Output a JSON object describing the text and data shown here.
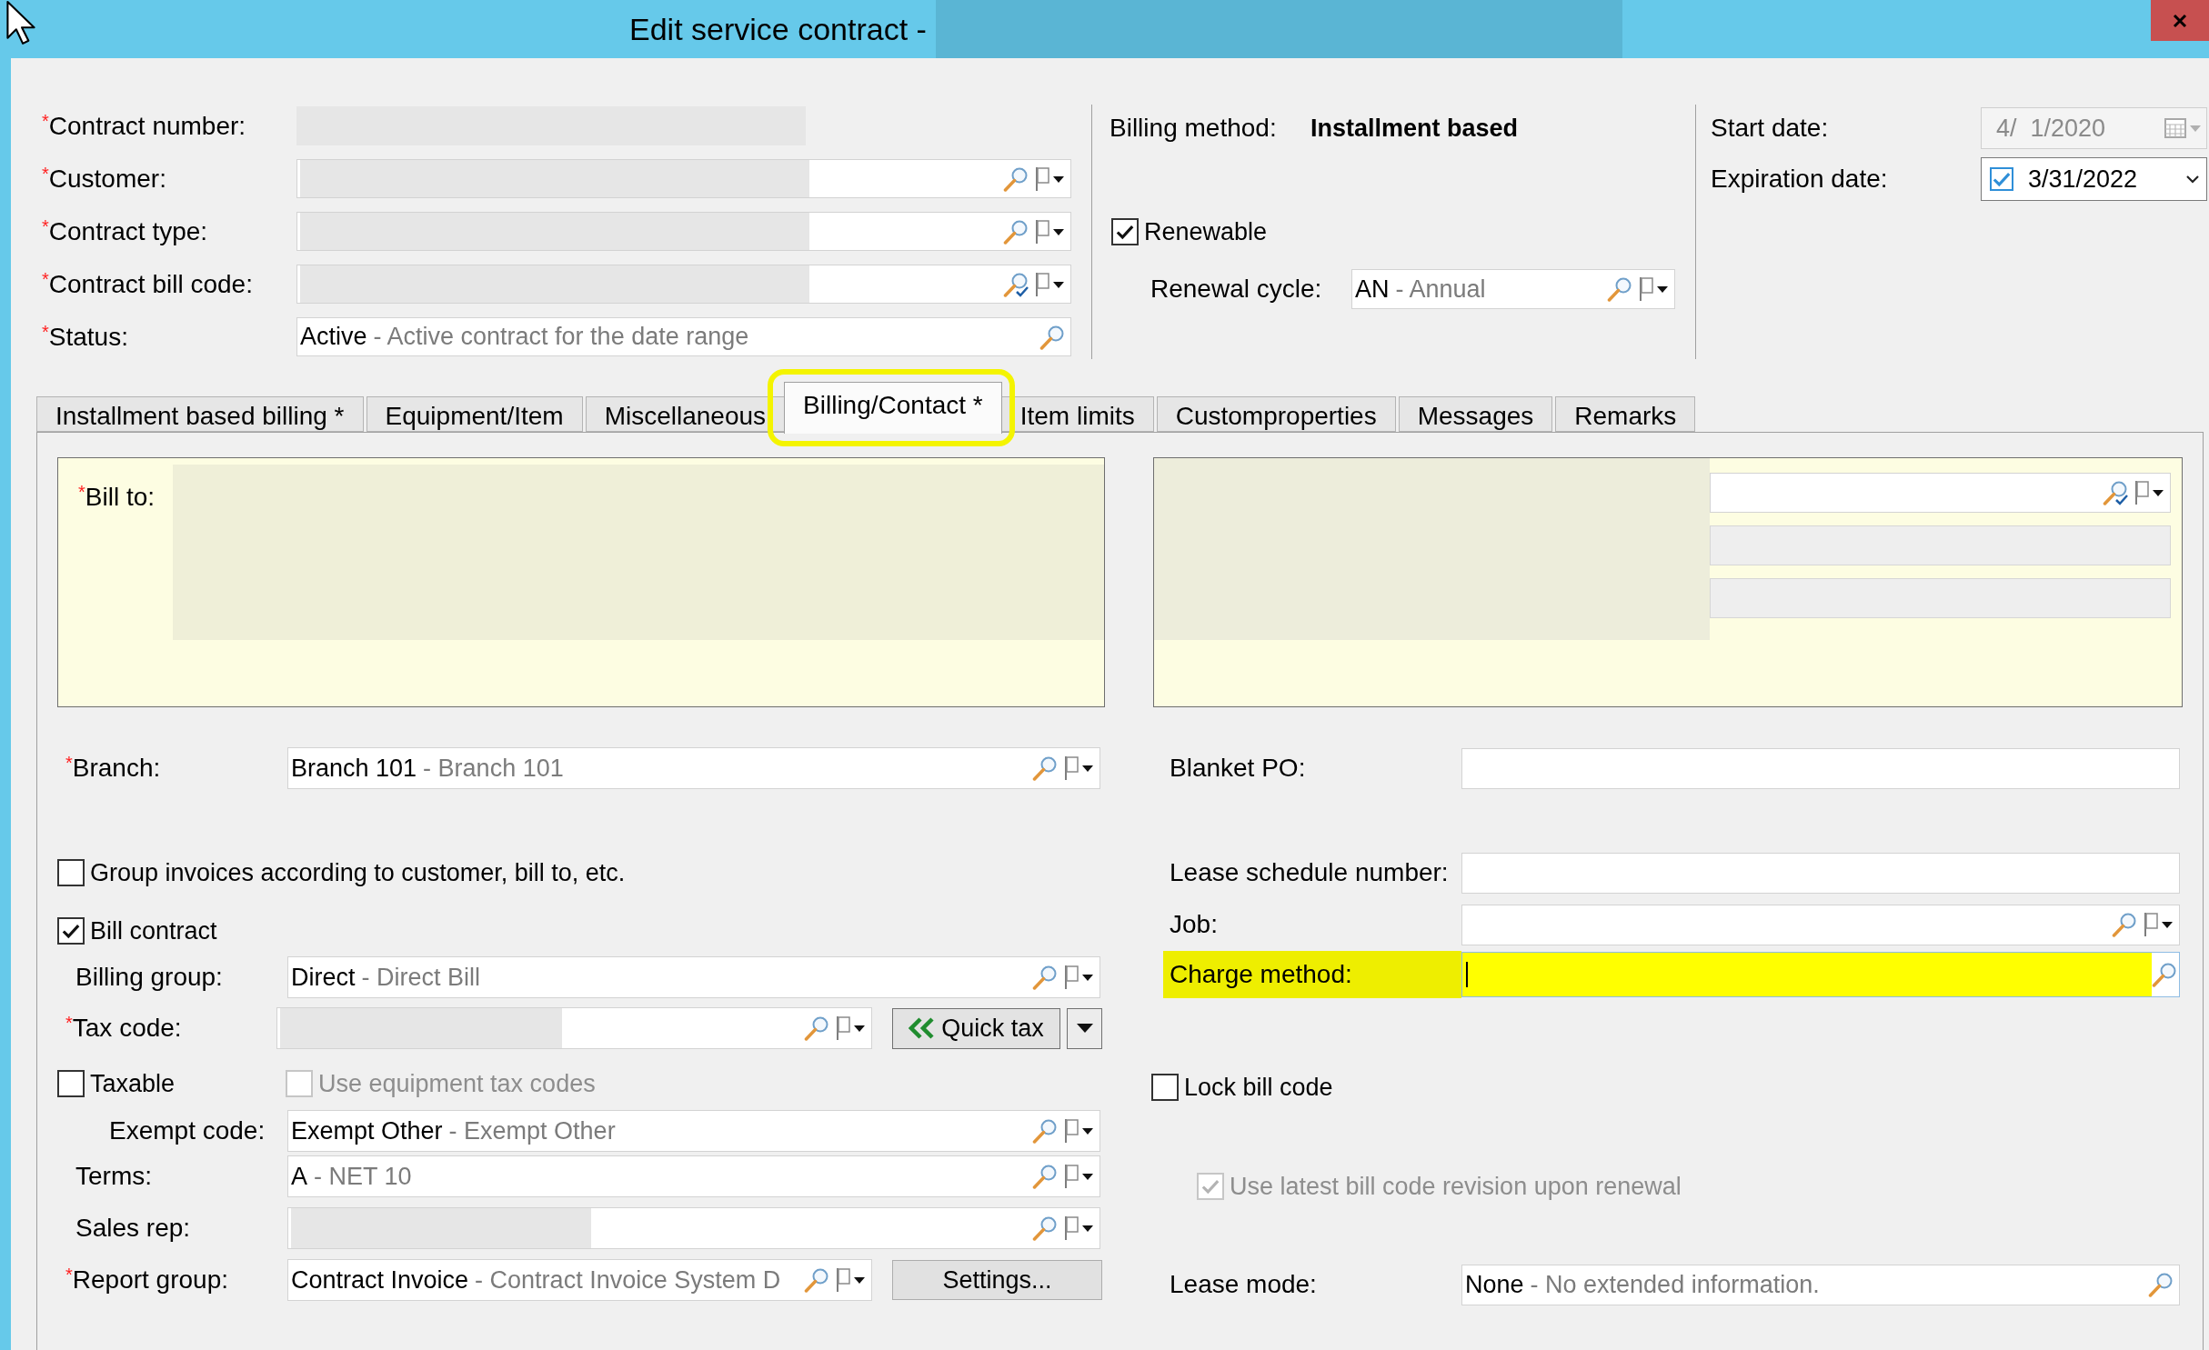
{
  "window": {
    "title": "Edit service contract -",
    "title_redacted": true
  },
  "header": {
    "fields": [
      {
        "kind": "text",
        "required_mark": "*",
        "label": "Contract number:",
        "redacted": true
      },
      {
        "kind": "lookup",
        "required_mark": "*",
        "label": "Customer:",
        "redacted": true
      },
      {
        "kind": "lookup",
        "required_mark": "*",
        "label": "Contract type:",
        "redacted": true
      },
      {
        "kind": "lookup_verify",
        "required_mark": "*",
        "label": "Contract bill code:",
        "redacted": true
      },
      {
        "kind": "search",
        "required_mark": "*",
        "label": "Status:",
        "redacted": false,
        "code": "Active",
        "description": "- Active contract for the date range"
      }
    ],
    "billing_method": {
      "label": "Billing method:",
      "value": "Installment based"
    },
    "renewable": {
      "label": "Renewable",
      "checked": true
    },
    "renewal_cycle": {
      "kind": "lookup",
      "label": "Renewal cycle:",
      "code": "AN",
      "description": "- Annual"
    },
    "start_date": {
      "label": "Start date:",
      "value": "4/  1/2020",
      "disabled": true
    },
    "expiration_date": {
      "label": "Expiration date:",
      "value": "3/31/2022",
      "checked": true
    }
  },
  "tabs": [
    {
      "label": "Installment based billing *",
      "selected": false,
      "highlighted": false
    },
    {
      "label": "Equipment/Item",
      "selected": false,
      "highlighted": false
    },
    {
      "label": "Miscellaneous",
      "selected": false,
      "highlighted": false
    },
    {
      "label": "Billing/Contact *",
      "selected": true,
      "highlighted": true
    },
    {
      "label": "Item limits",
      "selected": false,
      "highlighted": false
    },
    {
      "label": "Customproperties",
      "selected": false,
      "highlighted": false
    },
    {
      "label": "Messages",
      "selected": false,
      "highlighted": false
    },
    {
      "label": "Remarks",
      "selected": false,
      "highlighted": false
    }
  ],
  "bill_to": {
    "required_mark": "*",
    "label": "Bill to:",
    "redacted": true
  },
  "contact_box": {
    "redacted": true,
    "fields": [
      {
        "kind": "lookup_verify"
      },
      {
        "kind": "readonly"
      },
      {
        "kind": "readonly"
      }
    ]
  },
  "left": {
    "branch": {
      "kind": "lookup",
      "required_mark": "*",
      "label": "Branch:",
      "code": "Branch 101",
      "description": "- Branch 101"
    },
    "group_invoices": {
      "label": "Group invoices according to customer, bill to, etc.",
      "checked": false
    },
    "bill_contract": {
      "label": "Bill contract",
      "checked": true
    },
    "billing_group": {
      "kind": "lookup",
      "label": "Billing group:",
      "code": "Direct",
      "description": "- Direct Bill"
    },
    "tax_code": {
      "kind": "lookup",
      "required_mark": "*",
      "label": "Tax code:",
      "redacted": true
    },
    "quick_tax_button": {
      "label": "Quick tax"
    },
    "taxable": {
      "label": "Taxable",
      "checked": false
    },
    "use_equipment_tax_codes": {
      "label": "Use equipment tax codes",
      "checked": false,
      "disabled": true
    },
    "exempt_code": {
      "kind": "lookup",
      "label": "Exempt code:",
      "code": "Exempt Other",
      "description": "- Exempt Other"
    },
    "terms": {
      "kind": "lookup",
      "label": "Terms:",
      "code": "A",
      "description": "- NET 10"
    },
    "sales_rep": {
      "kind": "lookup",
      "label": "Sales rep:",
      "redacted": true
    },
    "report_group": {
      "kind": "lookup",
      "required_mark": "*",
      "label": "Report group:",
      "code": "Contract Invoice",
      "description": "- Contract Invoice System D"
    },
    "settings_button": {
      "label": "Settings..."
    }
  },
  "right": {
    "blanket_po": {
      "kind": "input",
      "label": "Blanket PO:"
    },
    "lease_schedule_number": {
      "kind": "input",
      "label": "Lease schedule number:"
    },
    "job": {
      "kind": "lookup",
      "label": "Job:"
    },
    "charge_method": {
      "kind": "search",
      "label": "Charge method:",
      "highlighted": true,
      "focused": true
    },
    "lock_bill_code": {
      "label": "Lock bill code",
      "checked": false
    },
    "use_latest_revision": {
      "label": "Use latest bill code revision upon renewal",
      "checked": true,
      "disabled": true
    },
    "lease_mode": {
      "kind": "search",
      "label": "Lease mode:",
      "code": "None",
      "description": "- No extended information."
    }
  }
}
